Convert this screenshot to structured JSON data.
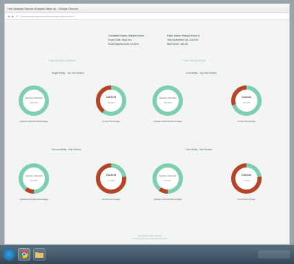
{
  "window": {
    "title": "Hue Analysis Sample Analysis Made up - Google Chrome",
    "url": "localhost/hue/analysis/result/summary/results.html?id=1"
  },
  "summary": {
    "rows": [
      "Candidate Name: Sample Name",
      "Exam Name: Sample Exam A",
      "Exam Date: Sept 2xx",
      "Total Submitted Qs: 100/100",
      "Exam Appeared At: 10:00 A",
      "Max Score: 100.00"
    ]
  },
  "sections": {
    "left_title": "Logical Ability Questions",
    "right_title": "Core Skill Questions",
    "groups": [
      "Single Ability - Top Sub Section",
      "Core Ability - Top Sub Section",
      "Second Ability - Sub Section",
      "Core Ability - Sub Section"
    ]
  },
  "donuts": [
    {
      "label": "Question Attended",
      "value": "100.00%",
      "type": "attended",
      "attended_fraction": 1.0,
      "caption": "Question Attended Percentage"
    },
    {
      "label": "Correct",
      "value": "40.00%",
      "type": "correct",
      "correct_fraction": 0.4,
      "caption": "Correct Percentage"
    },
    {
      "label": "Question Attended",
      "value": "100.00%",
      "type": "attended",
      "attended_fraction": 1.0,
      "caption": "Question Attended Percentage"
    },
    {
      "label": "Correct",
      "value": "30.00%",
      "type": "correct",
      "correct_fraction": 0.3,
      "caption": "Correct Percentage"
    },
    {
      "label": "Question Attended",
      "value": "90.00%",
      "type": "attended",
      "attended_fraction": 0.9,
      "caption": "Question Attended Percentage"
    },
    {
      "label": "Correct",
      "value": "77.00%",
      "type": "correct",
      "correct_fraction": 0.77,
      "caption": "Correct Percentage"
    },
    {
      "label": "Question Attended",
      "value": "90.00%",
      "type": "attended",
      "attended_fraction": 0.9,
      "caption": "Question Attended Percentage"
    },
    {
      "label": "Correct",
      "value": "77.00%",
      "type": "correct",
      "correct_fraction": 0.77,
      "caption": "Correct Percentage"
    }
  ],
  "footer": {
    "line1": "Copyright All rights reserved",
    "line2": "Product powered by Hue Analysis 2013"
  },
  "colors": {
    "green": "#7ecfaf",
    "red": "#b84327",
    "grey": "#cfd6d3"
  },
  "taskbar": {
    "icons": [
      "windows-start-icon",
      "chrome-icon",
      "folder-icon"
    ]
  }
}
